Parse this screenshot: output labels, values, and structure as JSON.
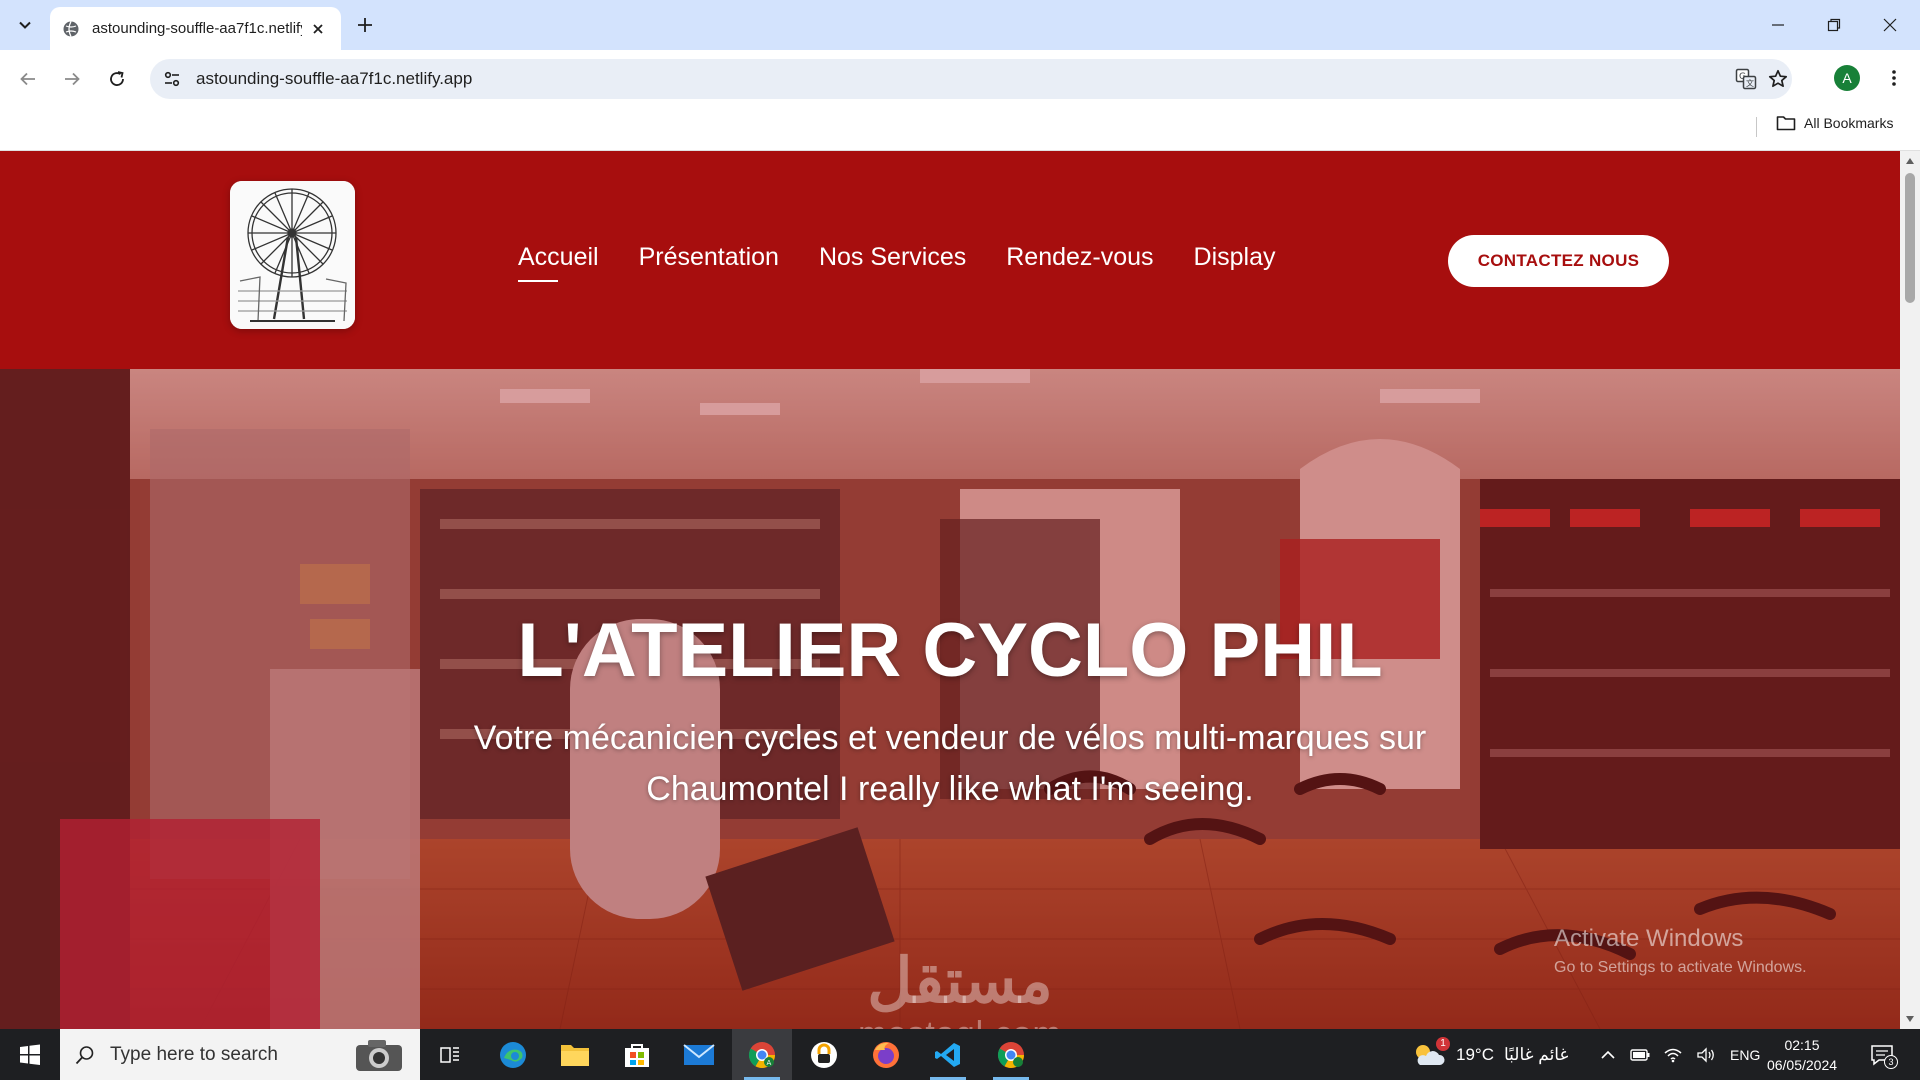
{
  "browser": {
    "tab_title": "astounding-souffle-aa7f1c.netlify.app",
    "url": "astounding-souffle-aa7f1c.netlify.app",
    "profile_initial": "A",
    "bookmarks_label": "All Bookmarks"
  },
  "site": {
    "nav": {
      "items": [
        {
          "label": "Accueil",
          "active": true
        },
        {
          "label": "Présentation"
        },
        {
          "label": "Nos Services"
        },
        {
          "label": "Rendez-vous"
        },
        {
          "label": "Display"
        }
      ],
      "cta": "CONTACTEZ NOUS"
    },
    "hero": {
      "title": "L'ATELIER CYCLO PHIL",
      "subtitle": "Votre mécanicien cycles et vendeur de vélos multi-marques sur Chaumontel I really like what I'm seeing."
    },
    "brand_color": "#a70e0e"
  },
  "overlays": {
    "activate_title": "Activate Windows",
    "activate_sub": "Go to Settings to activate Windows.",
    "watermark_ar": "مستقل",
    "watermark_en": "mostaql.com"
  },
  "taskbar": {
    "search_placeholder": "Type here to search",
    "weather_temp": "19°C",
    "weather_desc": "غائم غالبًا",
    "weather_badge": "1",
    "language": "ENG",
    "time": "02:15",
    "date": "06/05/2024",
    "notification_count": "3"
  }
}
